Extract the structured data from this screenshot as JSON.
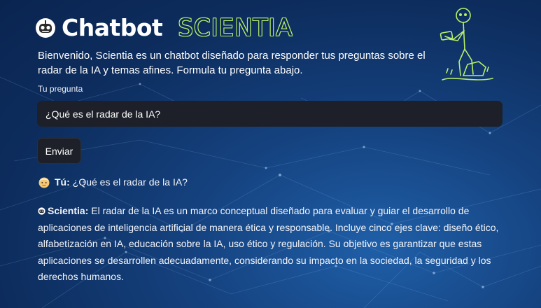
{
  "header": {
    "brand": "Chatbot",
    "title": "SCIENTIA",
    "logo_icon": "robot-face-icon",
    "mascot_icon": "stick-figure-reading-tablet-icon"
  },
  "intro": {
    "text": "Bienvenido, Scientia es un chatbot diseñado para responder tus preguntas sobre el radar de la IA y temas afines. Formula tu pregunta abajo."
  },
  "form": {
    "label": "Tu pregunta",
    "question_value": "¿Qué es el radar de la IA?",
    "send_label": "Enviar"
  },
  "conversation": {
    "user": {
      "speaker": "Tú:",
      "avatar_icon": "person-face-icon",
      "text": "¿Qué es el radar de la IA?"
    },
    "bot": {
      "speaker": "Scientia:",
      "avatar_icon": "robot-face-icon",
      "text": "El radar de la IA es un marco conceptual diseñado para evaluar y guiar el desarrollo de aplicaciones de inteligencia artificial de manera ética y responsable. Incluye cinco ejes clave: diseño ético, alfabetización en IA, educación sobre la IA, uso ético y regulación. Su objetivo es garantizar que estas aplicaciones se desarrollen adecuadamente, considerando su impacto en la sociedad, la seguridad y los derechos humanos."
    }
  },
  "colors": {
    "background": "#0d2d5e",
    "accent_green": "#b8f06a",
    "input_bg": "#1d2028"
  }
}
